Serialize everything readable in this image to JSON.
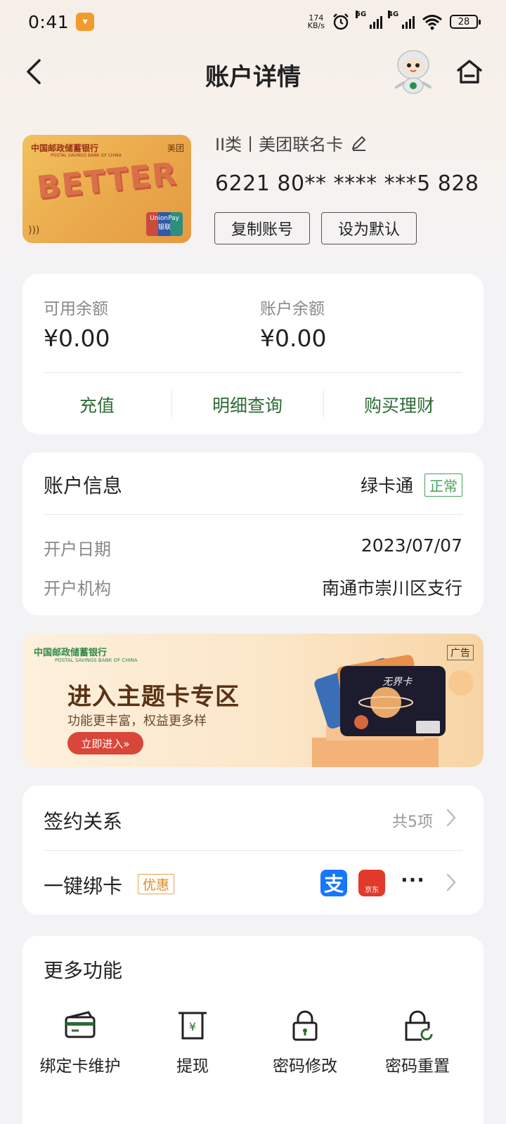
{
  "status_bar": {
    "time": "0:41",
    "net_speed_value": "174",
    "net_speed_unit": "KB/s",
    "sim1_tag": "5G",
    "sim2_tag": "4G",
    "battery": "28"
  },
  "header": {
    "title": "账户详情"
  },
  "card": {
    "bank_name": "中国邮政储蓄银行",
    "bank_name_en": "POSTAL SAVINGS BANK OF CHINA",
    "partner": "美团",
    "art_text": "BETTER",
    "union_pay": "UnionPay 银联",
    "type_label": "II类丨美团联名卡",
    "number": "6221 80** **** ***5 828",
    "copy_button": "复制账号",
    "default_button": "设为默认"
  },
  "balance": {
    "available_label": "可用余额",
    "available_value": "¥0.00",
    "account_label": "账户余额",
    "account_value": "¥0.00",
    "actions": [
      "充值",
      "明细查询",
      "购买理财"
    ]
  },
  "account_info": {
    "title": "账户信息",
    "product": "绿卡通",
    "status": "正常",
    "open_date_label": "开户日期",
    "open_date_value": "2023/07/07",
    "branch_label": "开户机构",
    "branch_value": "南通市崇川区支行"
  },
  "banner": {
    "bank_name": "中国邮政储蓄银行",
    "bank_name_en": "POSTAL SAVINGS BANK OF CHINA",
    "ad_tag": "广告",
    "title": "进入主题卡专区",
    "subtitle": "功能更丰富，权益更多样",
    "button": "立即进入»",
    "card_name": "无界卡"
  },
  "signing": {
    "title": "签约关系",
    "count": "共5项",
    "bind_title": "一键绑卡",
    "promo_tag": "优惠",
    "alipay_glyph": "支",
    "jd_label": "京东",
    "more": "···"
  },
  "more_functions": {
    "title": "更多功能",
    "items": [
      {
        "label": "绑定卡维护",
        "icon": "card-icon"
      },
      {
        "label": "提现",
        "icon": "withdraw-icon"
      },
      {
        "label": "密码修改",
        "icon": "lock-icon"
      },
      {
        "label": "密码重置",
        "icon": "lock-reset-icon"
      }
    ]
  },
  "colors": {
    "accent_green": "#2e6b36",
    "status_green": "#48a15a",
    "promo_orange": "#e08a22",
    "banner_button_red": "#d9463a"
  }
}
